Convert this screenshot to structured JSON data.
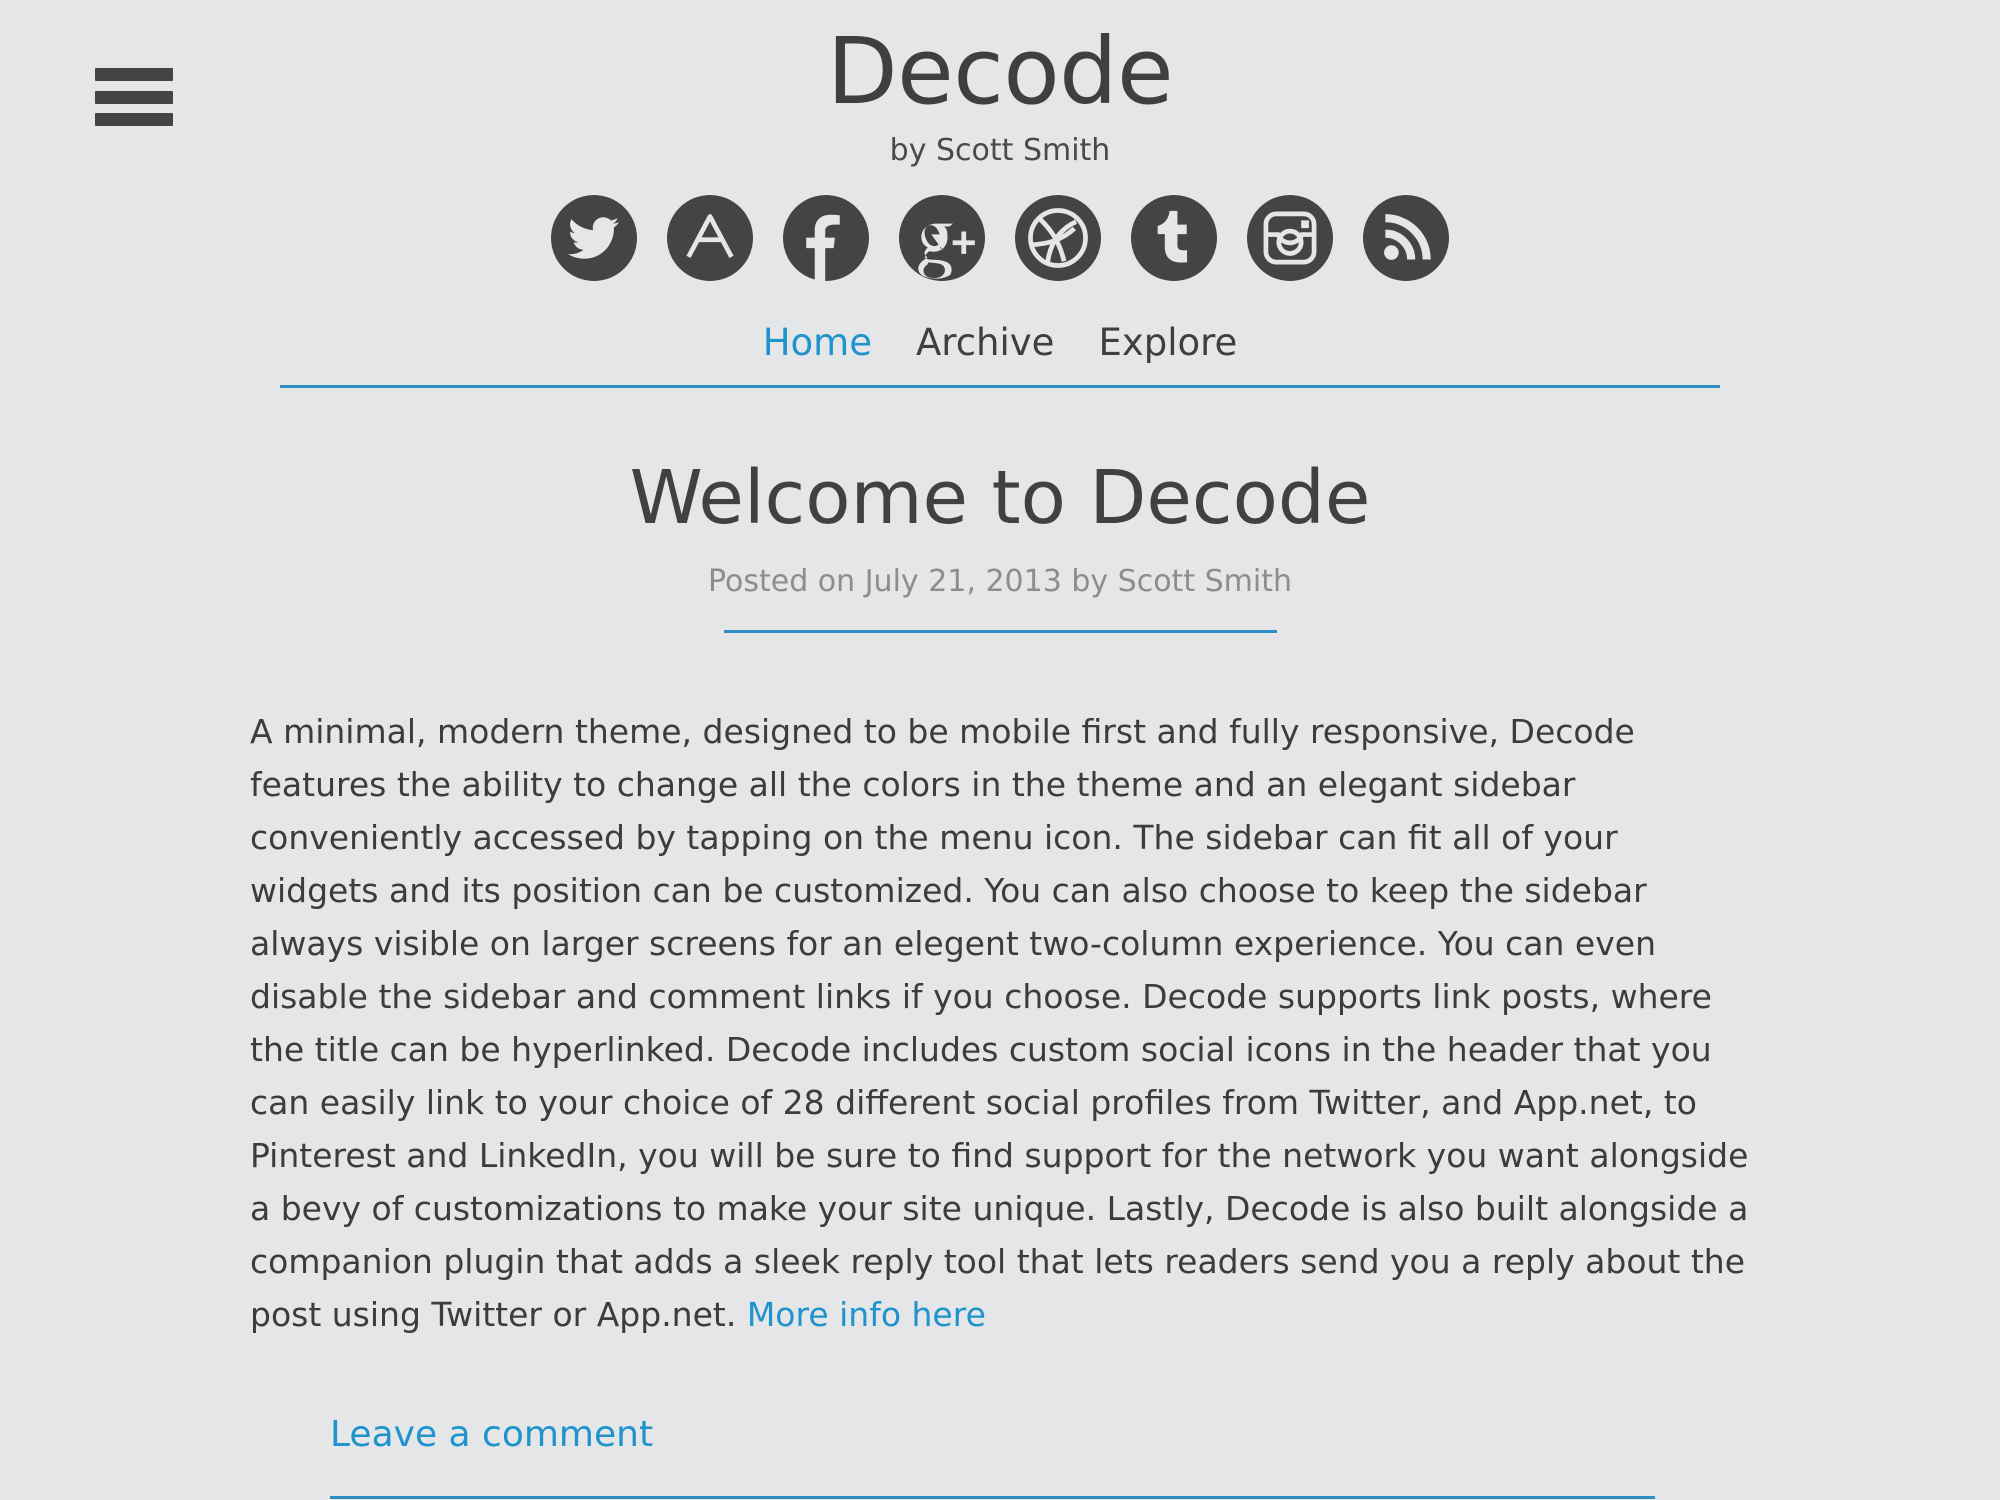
{
  "theme": {
    "background": "#e4e6e7",
    "accent": "#1f93cd",
    "rule": "#2f8fc4",
    "text": "#3c3c3c",
    "muted": "#8b8d8f",
    "icon": "#444444"
  },
  "header": {
    "menu_toggle_label": "Menu",
    "site_title": "Decode",
    "site_description": "by Scott Smith",
    "social_icons": [
      {
        "name": "twitter-icon",
        "label": "Twitter"
      },
      {
        "name": "appnet-icon",
        "label": "App.net"
      },
      {
        "name": "facebook-icon",
        "label": "Facebook"
      },
      {
        "name": "google-plus-icon",
        "label": "Google+"
      },
      {
        "name": "dribbble-icon",
        "label": "Dribbble"
      },
      {
        "name": "tumblr-icon",
        "label": "Tumblr"
      },
      {
        "name": "instagram-icon",
        "label": "Instagram"
      },
      {
        "name": "rss-icon",
        "label": "RSS"
      }
    ]
  },
  "nav": {
    "items": [
      {
        "label": "Home",
        "current": true
      },
      {
        "label": "Archive",
        "current": false
      },
      {
        "label": "Explore",
        "current": false
      }
    ]
  },
  "post": {
    "title": "Welcome to Decode",
    "meta": "Posted on July 21, 2013 by Scott Smith",
    "body_before_link": "A minimal, modern theme, designed to be mobile first and fully responsive, Decode features the ability to change all the colors in the theme and an elegant sidebar conveniently accessed by tapping on the menu icon. The sidebar can fit all of your widgets and its position can be customized. You can also choose to keep the sidebar always visible on larger screens for an elegent two-column experience. You can even disable the sidebar and comment links if you choose. Decode supports link posts, where the title can be hyperlinked. Decode includes custom social icons in the header that you can easily link to your choice of 28 different social profiles from Twitter, and App.net, to Pinterest and LinkedIn, you will be sure to find support for the network you want alongside a bevy of customizations to make your site unique. Lastly, Decode is also built alongside a companion plugin that adds a sleek reply tool that lets readers send you a reply about the post using Twitter or App.net. ",
    "body_link_text": "More info here",
    "comment_link": "Leave a comment"
  }
}
